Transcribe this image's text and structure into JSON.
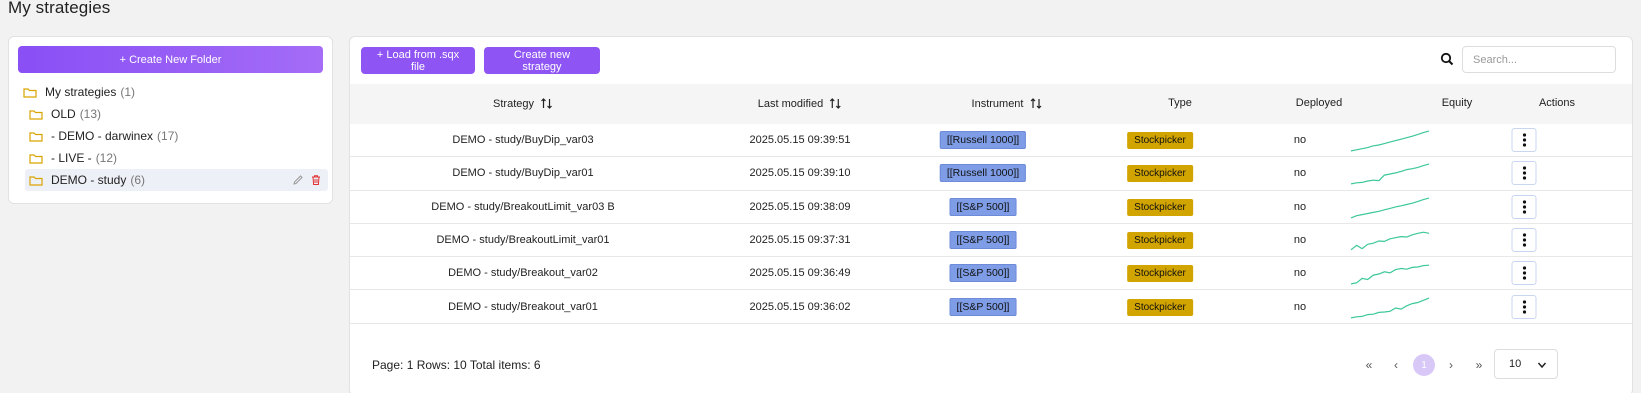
{
  "page": {
    "title": "My strategies"
  },
  "sidebar": {
    "create_folder_label": "+ Create New Folder",
    "root": {
      "label": "My strategies",
      "count": "(1)"
    },
    "folders": [
      {
        "label": "OLD",
        "count": "(13)"
      },
      {
        "label": "- DEMO - darwinex",
        "count": "(17)"
      },
      {
        "label": "- LIVE -",
        "count": "(12)"
      },
      {
        "label": "DEMO - study",
        "count": "(6)",
        "selected": true
      }
    ]
  },
  "toolbar": {
    "load_label": "+ Load from .sqx file",
    "create_label": "Create new strategy",
    "search_placeholder": "Search..."
  },
  "table": {
    "columns": {
      "strategy": "Strategy",
      "last_modified": "Last modified",
      "instrument": "Instrument",
      "type": "Type",
      "deployed": "Deployed",
      "equity": "Equity",
      "actions": "Actions"
    },
    "rows": [
      {
        "strategy": "DEMO - study/BuyDip_var03",
        "last_modified": "2025.05.15 09:39:51",
        "instrument": "[[Russell 1000]]",
        "type": "Stockpicker",
        "deployed": "no",
        "equity": [
          0.05,
          0.1,
          0.15,
          0.2,
          0.28,
          0.32,
          0.38,
          0.45,
          0.52,
          0.58,
          0.65,
          0.72,
          0.8,
          0.88,
          0.95
        ]
      },
      {
        "strategy": "DEMO - study/BuyDip_var01",
        "last_modified": "2025.05.15 09:39:10",
        "instrument": "[[Russell 1000]]",
        "type": "Stockpicker",
        "deployed": "no",
        "equity": [
          0.05,
          0.1,
          0.12,
          0.18,
          0.22,
          0.2,
          0.45,
          0.5,
          0.55,
          0.62,
          0.7,
          0.74,
          0.8,
          0.88,
          0.95
        ]
      },
      {
        "strategy": "DEMO - study/BreakoutLimit_var03 B",
        "last_modified": "2025.05.15 09:38:09",
        "instrument": "[[S&P 500]]",
        "type": "Stockpicker",
        "deployed": "no",
        "equity": [
          0.05,
          0.15,
          0.2,
          0.25,
          0.3,
          0.35,
          0.42,
          0.48,
          0.55,
          0.6,
          0.66,
          0.72,
          0.8,
          0.88,
          0.95
        ]
      },
      {
        "strategy": "DEMO - study/BreakoutLimit_var01",
        "last_modified": "2025.05.15 09:37:31",
        "instrument": "[[S&P 500]]",
        "type": "Stockpicker",
        "deployed": "no",
        "equity": [
          0.1,
          0.3,
          0.15,
          0.35,
          0.4,
          0.5,
          0.48,
          0.6,
          0.65,
          0.7,
          0.68,
          0.78,
          0.85,
          0.9,
          0.85
        ]
      },
      {
        "strategy": "DEMO - study/Breakout_var02",
        "last_modified": "2025.05.15 09:36:49",
        "instrument": "[[S&P 500]]",
        "type": "Stockpicker",
        "deployed": "no",
        "equity": [
          0.05,
          0.1,
          0.3,
          0.25,
          0.45,
          0.5,
          0.6,
          0.55,
          0.7,
          0.75,
          0.72,
          0.8,
          0.82,
          0.88,
          0.9
        ]
      },
      {
        "strategy": "DEMO - study/Breakout_var01",
        "last_modified": "2025.05.15 09:36:02",
        "instrument": "[[S&P 500]]",
        "type": "Stockpicker",
        "deployed": "no",
        "equity": [
          0.05,
          0.1,
          0.12,
          0.2,
          0.22,
          0.3,
          0.32,
          0.35,
          0.5,
          0.45,
          0.6,
          0.7,
          0.75,
          0.85,
          0.95
        ]
      }
    ]
  },
  "footer": {
    "summary": "Page: 1 Rows: 10 Total items: 6",
    "first_label": "«",
    "prev_label": "‹",
    "current_page": "1",
    "next_label": "›",
    "last_label": "»",
    "page_size": "10"
  },
  "colors": {
    "accent": "#8e55f4",
    "equity_line": "#3cc89a",
    "instrument_badge": "#7f9de6",
    "type_badge": "#d2a400",
    "folder_icon": "#d9a400"
  },
  "icons": {
    "folder": "folder-icon",
    "edit": "pencil-icon",
    "delete": "trash-icon",
    "search": "search-icon",
    "sort": "sort-icon",
    "actions": "kebab-icon"
  }
}
